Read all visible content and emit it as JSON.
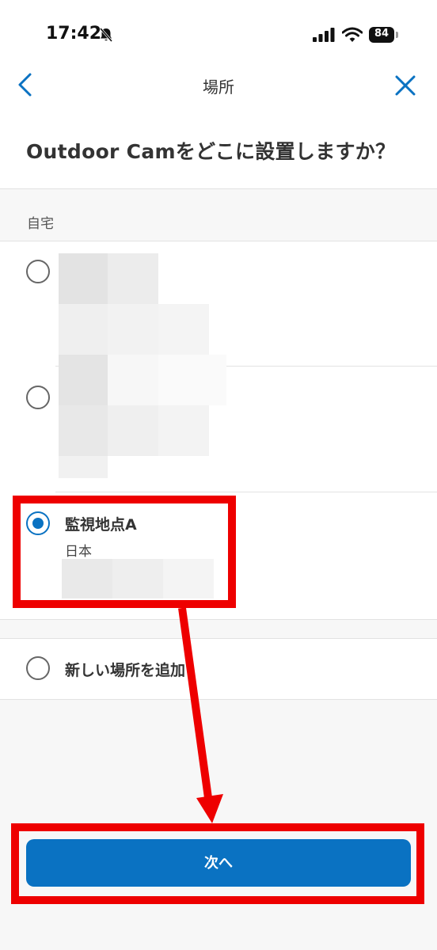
{
  "status_bar": {
    "time": "17:42",
    "battery": "84"
  },
  "header": {
    "title": "場所",
    "question": "Outdoor Camをどこに設置しますか？"
  },
  "section": {
    "label": "自宅"
  },
  "locations": [
    {
      "name": "",
      "country": "",
      "selected": false
    },
    {
      "name": "",
      "country": "",
      "selected": false
    },
    {
      "name": "監視地点A",
      "country": "日本",
      "selected": true
    }
  ],
  "add_location": {
    "label": "新しい場所を追加"
  },
  "next_button": {
    "label": "次へ"
  },
  "colors": {
    "accent": "#0a72c2",
    "annotation": "#ee0000"
  }
}
